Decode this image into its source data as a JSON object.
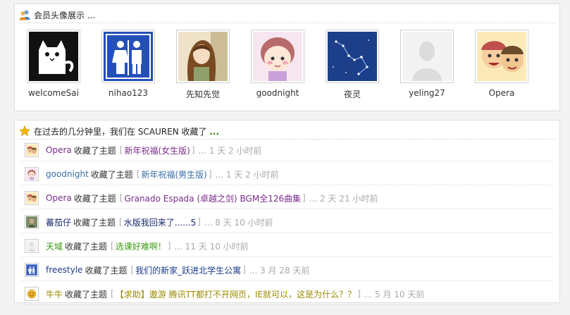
{
  "avatars_panel": {
    "title": "会员头像展示 ...",
    "members": [
      {
        "name": "welcomeSai",
        "icon": "white-cat-avatar"
      },
      {
        "name": "nihao123",
        "icon": "restroom-sign-avatar"
      },
      {
        "name": "先知先觉",
        "icon": "anime-girl-avatar"
      },
      {
        "name": "goodnight",
        "icon": "cartoon-girl-avatar"
      },
      {
        "name": "夜灵",
        "icon": "constellation-avatar"
      },
      {
        "name": "yeling27",
        "icon": "default-silhouette-avatar"
      },
      {
        "name": "Opera",
        "icon": "cartoon-boys-avatar"
      }
    ]
  },
  "activity_panel": {
    "title": "在过去的几分钟里，我们在 SCAUREN 收藏了",
    "title_dots": "...",
    "items": [
      {
        "user": "Opera",
        "action": "收藏了主题",
        "topic": "新年祝福(女生版)",
        "time": "... 1 天 2 小时前",
        "user_color": "#7a2c8a",
        "topic_color": "#7a2c8a",
        "icon": "cartoon-boys-avatar"
      },
      {
        "user": "goodnight",
        "action": "收藏了主题",
        "topic": "新年祝福(男生版)",
        "time": "... 1 天 2 小时前",
        "user_color": "#3a6ea5",
        "topic_color": "#3a6ea5",
        "icon": "cartoon-girl-avatar"
      },
      {
        "user": "Opera",
        "action": "收藏了主题",
        "topic": "Granado Espada (卓越之剑) BGM全126曲集",
        "time": "... 2 天 21 小时前",
        "user_color": "#7a2c8a",
        "topic_color": "#7a2c8a",
        "icon": "cartoon-boys-avatar"
      },
      {
        "user": "蕃茄仔",
        "action": "收藏了主题",
        "topic": "水版我回来了......5",
        "time": "... 8 天 10 小时前",
        "user_color": "#1a2a6a",
        "topic_color": "#1a2a6a",
        "icon": "photo-avatar"
      },
      {
        "user": "天域",
        "action": "收藏了主题",
        "topic": "选课好难啊！",
        "time": "... 11 天 10 小时前",
        "user_color": "#3a9a10",
        "topic_color": "#3a9a10",
        "icon": "default-silhouette-avatar"
      },
      {
        "user": "freestyle",
        "action": "收藏了主题",
        "topic": "我们的新家_跃进北学生公寓",
        "time": "... 3 月 28 天前",
        "user_color": "#1a3a8a",
        "topic_color": "#1a3a8a",
        "icon": "restroom-sign-avatar"
      },
      {
        "user": "牛牛",
        "action": "收藏了主题",
        "topic": "【求助】遨游 腾讯TT都打不开网页，IE就可以，这是为什么？？",
        "time": "... 5 月 10 天前",
        "user_color": "#9a8a00",
        "topic_color": "#9a8a00",
        "icon": "smiley-avatar"
      }
    ]
  },
  "colors": {
    "panel_bg": "#ffffff",
    "page_bg": "#f2f2f2",
    "muted": "#aaaaaa",
    "accent_green": "#2a7a00"
  }
}
